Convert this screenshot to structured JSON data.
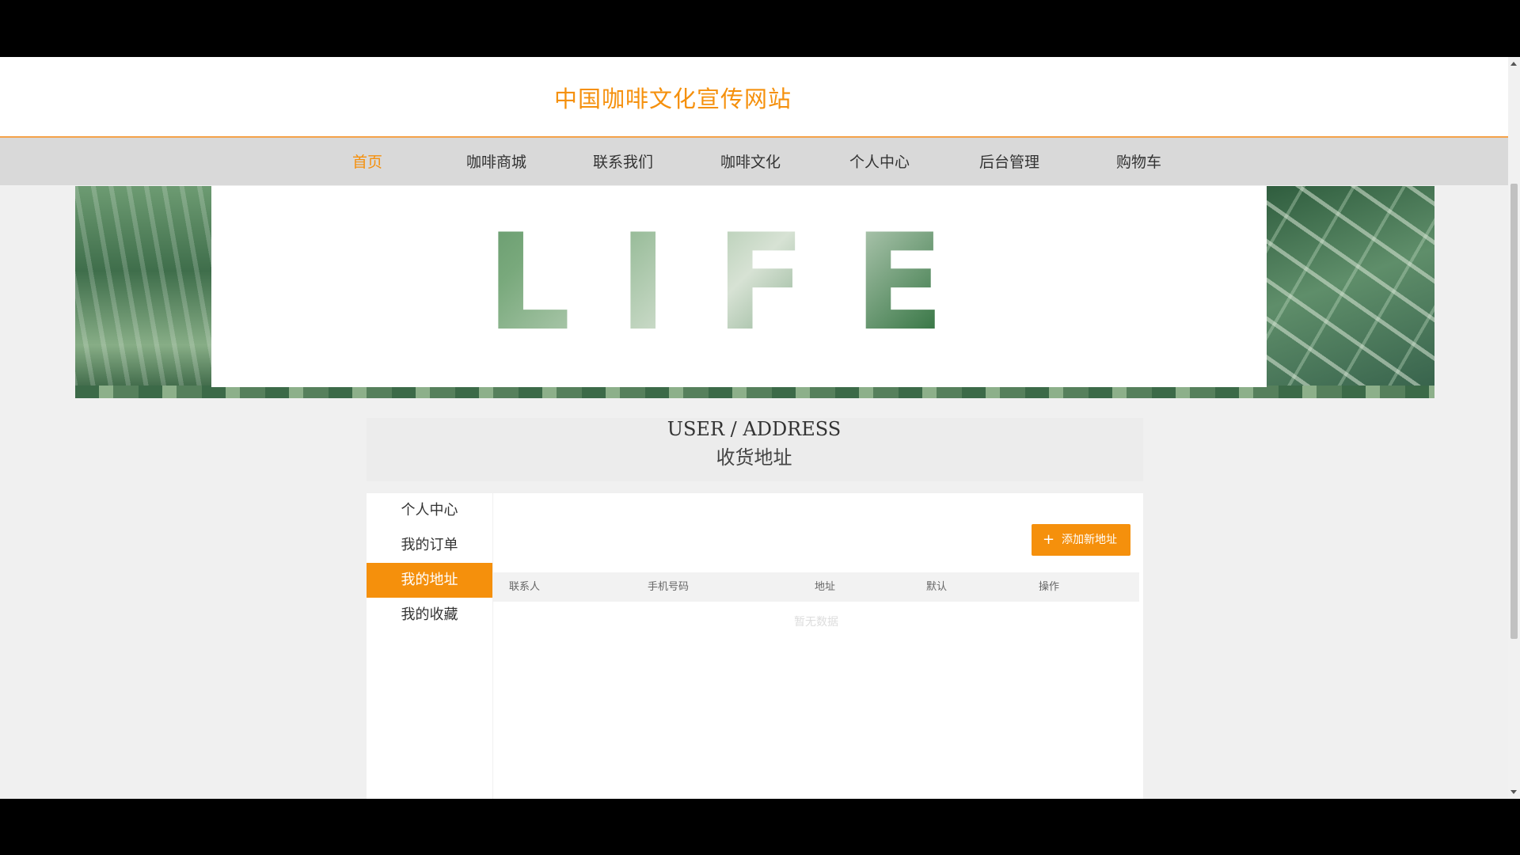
{
  "site": {
    "title": "中国咖啡文化宣传网站"
  },
  "nav": {
    "items": [
      {
        "label": "首页"
      },
      {
        "label": "咖啡商城"
      },
      {
        "label": "联系我们"
      },
      {
        "label": "咖啡文化"
      },
      {
        "label": "个人中心"
      },
      {
        "label": "后台管理"
      },
      {
        "label": "购物车"
      }
    ],
    "active_index": 0
  },
  "banner": {
    "word": "LIFE",
    "slides": 3,
    "active_slide": 0
  },
  "section": {
    "title_en": "USER / ADDRESS",
    "title_zh": "收货地址"
  },
  "sidebar": {
    "items": [
      {
        "label": "个人中心"
      },
      {
        "label": "我的订单"
      },
      {
        "label": "我的地址"
      },
      {
        "label": "我的收藏"
      }
    ],
    "active_index": 2
  },
  "address": {
    "add_button": {
      "icon": "plus-icon",
      "label": "添加新地址"
    },
    "columns": [
      "联系人",
      "手机号码",
      "地址",
      "默认",
      "操作"
    ],
    "rows": [],
    "empty_text": "暂无数据"
  },
  "colors": {
    "accent": "#f5900c",
    "nav_bg": "#d9d9d9",
    "page_bg": "#f0f0f0"
  }
}
